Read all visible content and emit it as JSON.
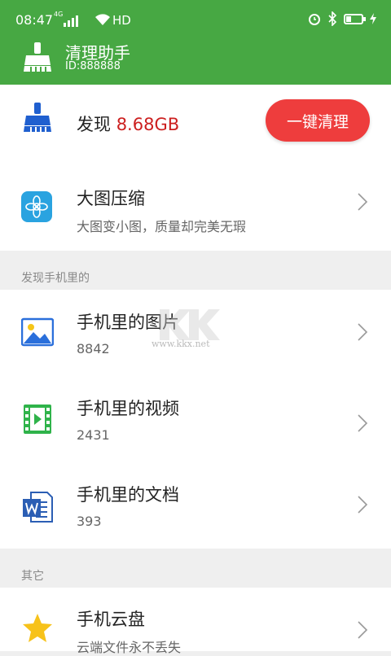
{
  "status_bar": {
    "time": "08:47",
    "network_1": "4G",
    "network_2": "4G",
    "hd": "HD",
    "battery_level": 0.35
  },
  "header": {
    "title": "清理助手",
    "id_text": "ID:888888",
    "bg_color": "#47a843"
  },
  "cleanup": {
    "found_label": "发现",
    "found_size": "8.68GB",
    "button_label": "一键清理",
    "button_color": "#ee3d3d"
  },
  "compress": {
    "title": "大图压缩",
    "subtitle": "大图变小图，质量却完美无瑕"
  },
  "section_phone": {
    "label": "发现手机里的",
    "items": [
      {
        "icon": "image-icon",
        "title": "手机里的图片",
        "count": "8842"
      },
      {
        "icon": "video-icon",
        "title": "手机里的视频",
        "count": "2431"
      },
      {
        "icon": "word-document-icon",
        "title": "手机里的文档",
        "count": "393"
      }
    ]
  },
  "section_other": {
    "label": "其它",
    "items": [
      {
        "icon": "star-icon",
        "title": "手机云盘",
        "subtitle": "云端文件永不丢失"
      }
    ]
  },
  "watermark": {
    "url": "www.kkx.net"
  }
}
